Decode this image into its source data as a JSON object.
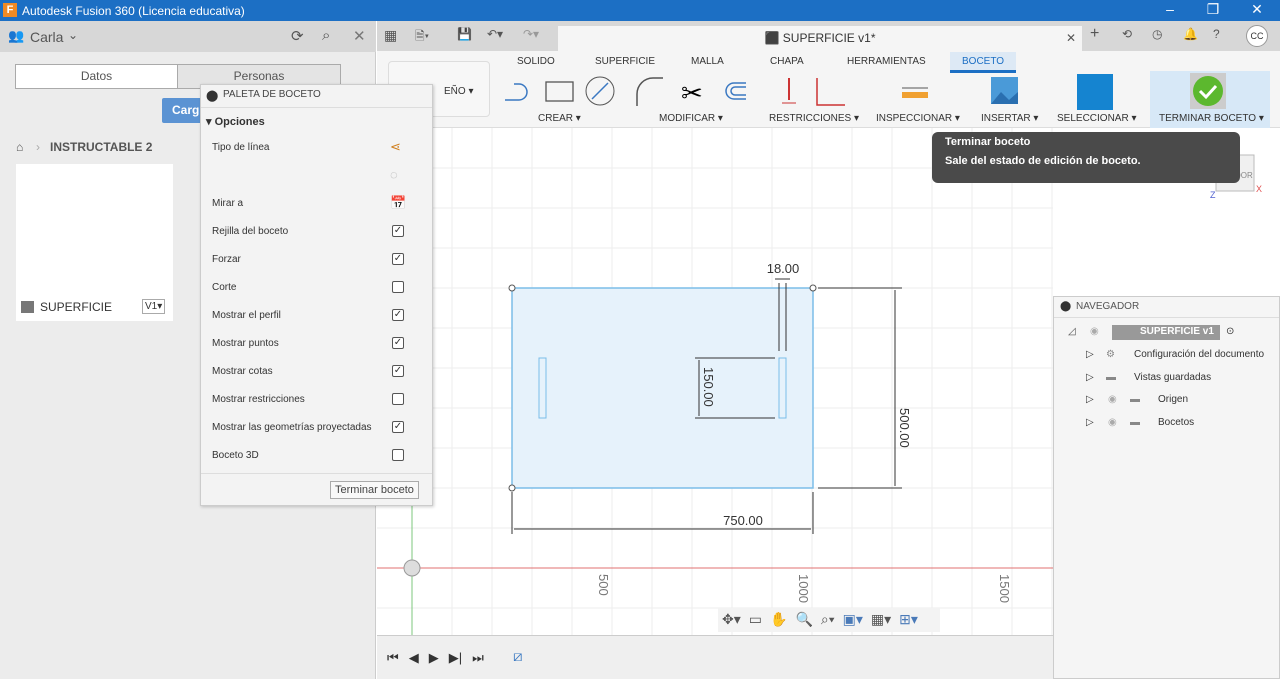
{
  "window": {
    "title": "Autodesk Fusion 360 (Licencia educativa)",
    "logo": "F"
  },
  "left": {
    "user": "Carla",
    "tabs": [
      "Datos",
      "Personas"
    ],
    "upload": "Carg",
    "breadcrumb": "INSTRUCTABLE 2",
    "file": {
      "name": "SUPERFICIE",
      "version": "V1▾"
    }
  },
  "doc": {
    "title": "SUPERFICIE v1*"
  },
  "ribbon": {
    "workspace": "EÑO ▾",
    "tabs": [
      "SOLIDO",
      "SUPERFICIE",
      "MALLA",
      "CHAPA",
      "HERRAMIENTAS",
      "BOCETO"
    ],
    "active_tab": "BOCETO",
    "groups": [
      "CREAR ▾",
      "MODIFICAR ▾",
      "RESTRICCIONES ▾",
      "INSPECCIONAR ▾",
      "INSERTAR ▾",
      "SELECCIONAR ▾",
      "TERMINAR BOCETO ▾"
    ]
  },
  "tooltip": {
    "title": "Terminar boceto",
    "desc": "Sale del estado de edición de boceto."
  },
  "palette": {
    "title": "PALETA DE BOCETO",
    "section": "Opciones",
    "rows": [
      {
        "label": "Tipo de línea",
        "type": "icon"
      },
      {
        "label": "",
        "type": "icon"
      },
      {
        "label": "Mirar a",
        "type": "icon"
      },
      {
        "label": "Rejilla del boceto",
        "checked": true
      },
      {
        "label": "Forzar",
        "checked": true
      },
      {
        "label": "Corte",
        "checked": false
      },
      {
        "label": "Mostrar el perfil",
        "checked": true
      },
      {
        "label": "Mostrar puntos",
        "checked": true
      },
      {
        "label": "Mostrar cotas",
        "checked": true
      },
      {
        "label": "Mostrar restricciones",
        "checked": false
      },
      {
        "label": "Mostrar las geometrías proyectadas",
        "checked": true
      },
      {
        "label": "Boceto 3D",
        "checked": false
      }
    ],
    "finish": "Terminar boceto"
  },
  "sketch": {
    "dims": {
      "width": "750.00",
      "height": "500.00",
      "slot_height": "150.00",
      "slot_width": "18.00"
    },
    "axis_labels": [
      "500",
      "1000",
      "1500"
    ],
    "viewcube": "DOR"
  },
  "navigator": {
    "title": "NAVEGADOR",
    "root": "SUPERFICIE v1",
    "items": [
      "Configuración del documento",
      "Vistas guardadas",
      "Origen",
      "Bocetos"
    ]
  },
  "colors": {
    "accent": "#1c6fc4",
    "sketch_fill": "#e6f2fb",
    "sketch_line": "#7bbde8",
    "finish_green": "#5cb82e"
  }
}
